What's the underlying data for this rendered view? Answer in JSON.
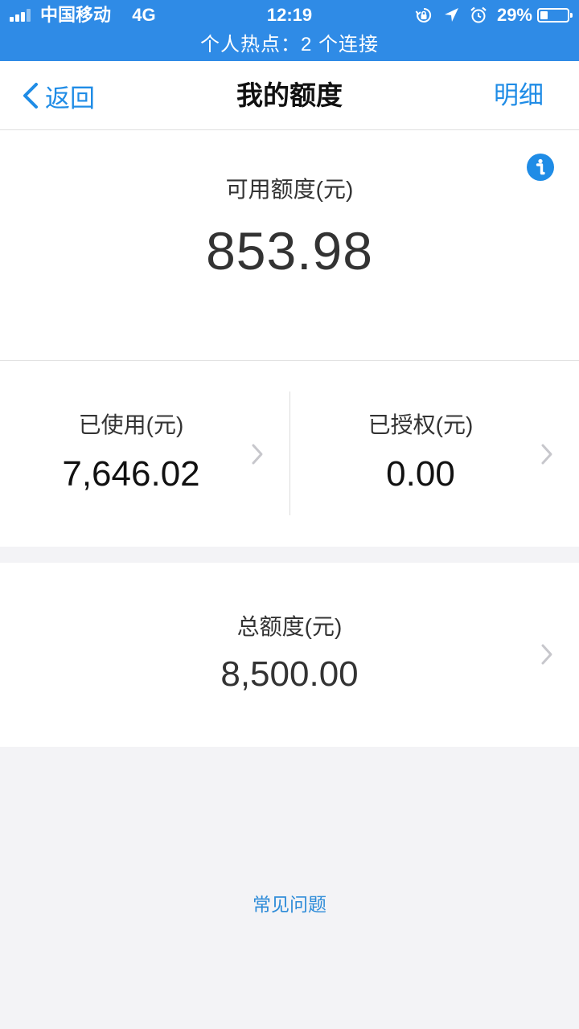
{
  "status_bar": {
    "carrier": "中国移动",
    "network": "4G",
    "time": "12:19",
    "battery_percent_label": "29%",
    "battery_level": 0.29,
    "signal_bars": 3,
    "icons": [
      "rotation-lock-icon",
      "location-arrow-icon",
      "alarm-clock-icon"
    ],
    "background_color": "#2f8be6"
  },
  "hotspot_banner": {
    "text": "个人热点：2 个连接"
  },
  "nav": {
    "back_label": "返回",
    "title": "我的额度",
    "detail_label": "明细",
    "accent_color": "#1f8ce6"
  },
  "available": {
    "label": "可用额度(元)",
    "value": "853.98",
    "info_icon": "info-icon"
  },
  "used": {
    "label": "已使用(元)",
    "value": "7,646.02"
  },
  "authorized": {
    "label": "已授权(元)",
    "value": "0.00"
  },
  "total": {
    "label": "总额度(元)",
    "value": "8,500.00"
  },
  "faq": {
    "label": "常见问题"
  }
}
